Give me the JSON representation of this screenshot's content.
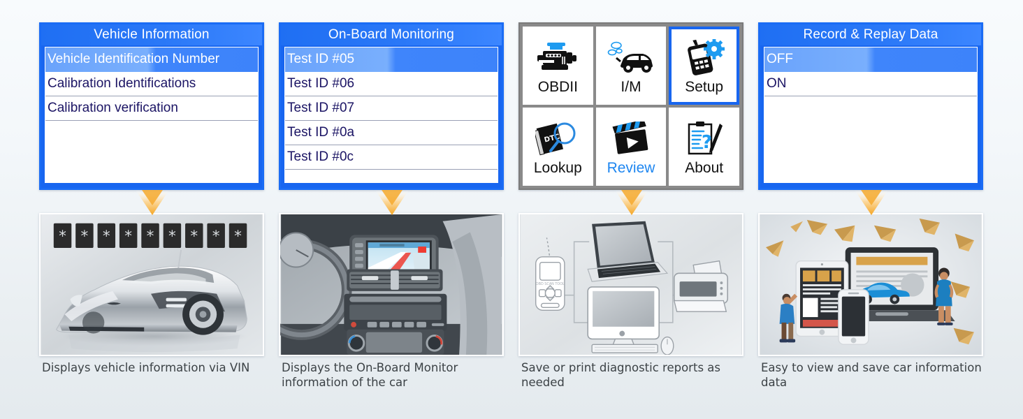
{
  "theme": {
    "accent_blue": "#1866f0",
    "highlight_blue": "#6aa3fb",
    "menu_text": "#1b1464",
    "arrow_orange": "#f5a623",
    "grid_border_gray": "#8a8a8a",
    "background": "#f3f7fa"
  },
  "columns": [
    {
      "screen": {
        "title": "Vehicle Information",
        "items": [
          {
            "label": "Vehicle Identification Number",
            "selected": true
          },
          {
            "label": "Calibration Identifications",
            "selected": false
          },
          {
            "label": "Calibration verification",
            "selected": false
          }
        ]
      },
      "photo": {
        "alt": "silver sports car with nine masked VIN character tiles"
      },
      "caption": "Displays vehicle information via VIN"
    },
    {
      "screen": {
        "title": "On-Board Monitoring",
        "items": [
          {
            "label": "Test ID #05",
            "selected": true
          },
          {
            "label": "Test ID #06",
            "selected": false
          },
          {
            "label": "Test ID #07",
            "selected": false
          },
          {
            "label": "Test ID #0a",
            "selected": false
          },
          {
            "label": "Test ID #0c",
            "selected": false
          }
        ]
      },
      "photo": {
        "alt": "car dashboard centre console with navigation screen"
      },
      "caption": "Displays the On-Board Monitor information of the car"
    },
    {
      "grid": {
        "tiles": [
          {
            "label": "OBDII",
            "icon": "engine-icon",
            "selected": false,
            "label_blue": false
          },
          {
            "label": "I/M",
            "icon": "car-emission-icon",
            "selected": false,
            "label_blue": false
          },
          {
            "label": "Setup",
            "icon": "scanner-gear-icon",
            "selected": true,
            "label_blue": false
          },
          {
            "label": "Lookup",
            "icon": "dtc-magnifier-icon",
            "selected": false,
            "label_blue": false
          },
          {
            "label": "Review",
            "icon": "clapperboard-icon",
            "selected": false,
            "label_blue": true
          },
          {
            "label": "About",
            "icon": "clipboard-pen-icon",
            "selected": false,
            "label_blue": false
          }
        ]
      },
      "photo": {
        "alt": "scan tool connected to laptop, desktop computer and printer"
      },
      "caption": "Save or print diagnostic reports as needed"
    },
    {
      "screen": {
        "title": "Record & Replay Data",
        "items": [
          {
            "label": "OFF",
            "selected": true
          },
          {
            "label": "ON",
            "selected": false
          }
        ]
      },
      "photo": {
        "alt": "people viewing car data on tablet, phone and laptop with paper planes"
      },
      "caption": "Easy to view and save car information data"
    }
  ]
}
